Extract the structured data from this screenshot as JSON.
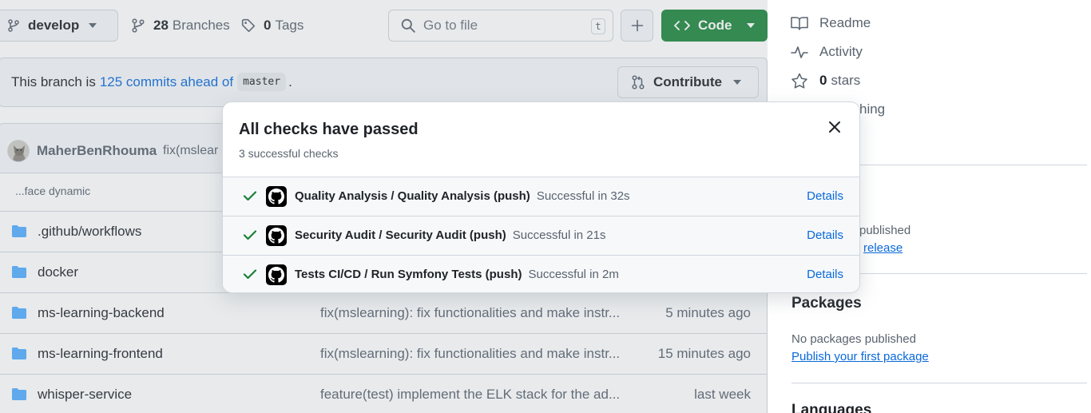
{
  "toolbar": {
    "branch": "develop",
    "branches_count": "28",
    "branches_label": "Branches",
    "tags_count": "0",
    "tags_label": "Tags",
    "search_placeholder": "Go to file",
    "search_shortcut": "t",
    "code_label": "Code"
  },
  "branch_status": {
    "prefix": "This branch is",
    "link": "125 commits ahead of",
    "base": "master",
    "suffix": ".",
    "contribute_label": "Contribute"
  },
  "latest_commit": {
    "author": "MaherBenRhouma",
    "message": "fix(mslear",
    "subtext": "...face dynamic"
  },
  "files": [
    {
      "name": ".github/workflows",
      "message": "",
      "time": ""
    },
    {
      "name": "docker",
      "message": "",
      "time": ""
    },
    {
      "name": "ms-learning-backend",
      "message": "fix(mslearning): fix functionalities and make instr...",
      "time": "5 minutes ago"
    },
    {
      "name": "ms-learning-frontend",
      "message": "fix(mslearning): fix functionalities and make instr...",
      "time": "15 minutes ago"
    },
    {
      "name": "whisper-service",
      "message": "feature(test) implement the ELK stack for the ad...",
      "time": "last week"
    }
  ],
  "sidebar": {
    "readme": "Readme",
    "activity": "Activity",
    "stars_count": "0",
    "stars_label": "stars",
    "watching_partial": "hing",
    "releases_published_partial": "published",
    "release_link_partial": "release",
    "packages_title": "Packages",
    "packages_none": "No packages published",
    "packages_link": "Publish your first package",
    "languages_title": "Languages"
  },
  "checks_popover": {
    "title": "All checks have passed",
    "subtitle": "3 successful checks",
    "checks": [
      {
        "name": "Quality Analysis / Quality Analysis (push)",
        "status": "Successful in 32s",
        "details": "Details"
      },
      {
        "name": "Security Audit / Security Audit (push)",
        "status": "Successful in 21s",
        "details": "Details"
      },
      {
        "name": "Tests CI/CD / Run Symfony Tests (push)",
        "status": "Successful in 2m",
        "details": "Details"
      }
    ]
  },
  "colors": {
    "code_button": "#1f883d",
    "link": "#0969da",
    "folder": "#54aeff",
    "success": "#1a7f37"
  }
}
